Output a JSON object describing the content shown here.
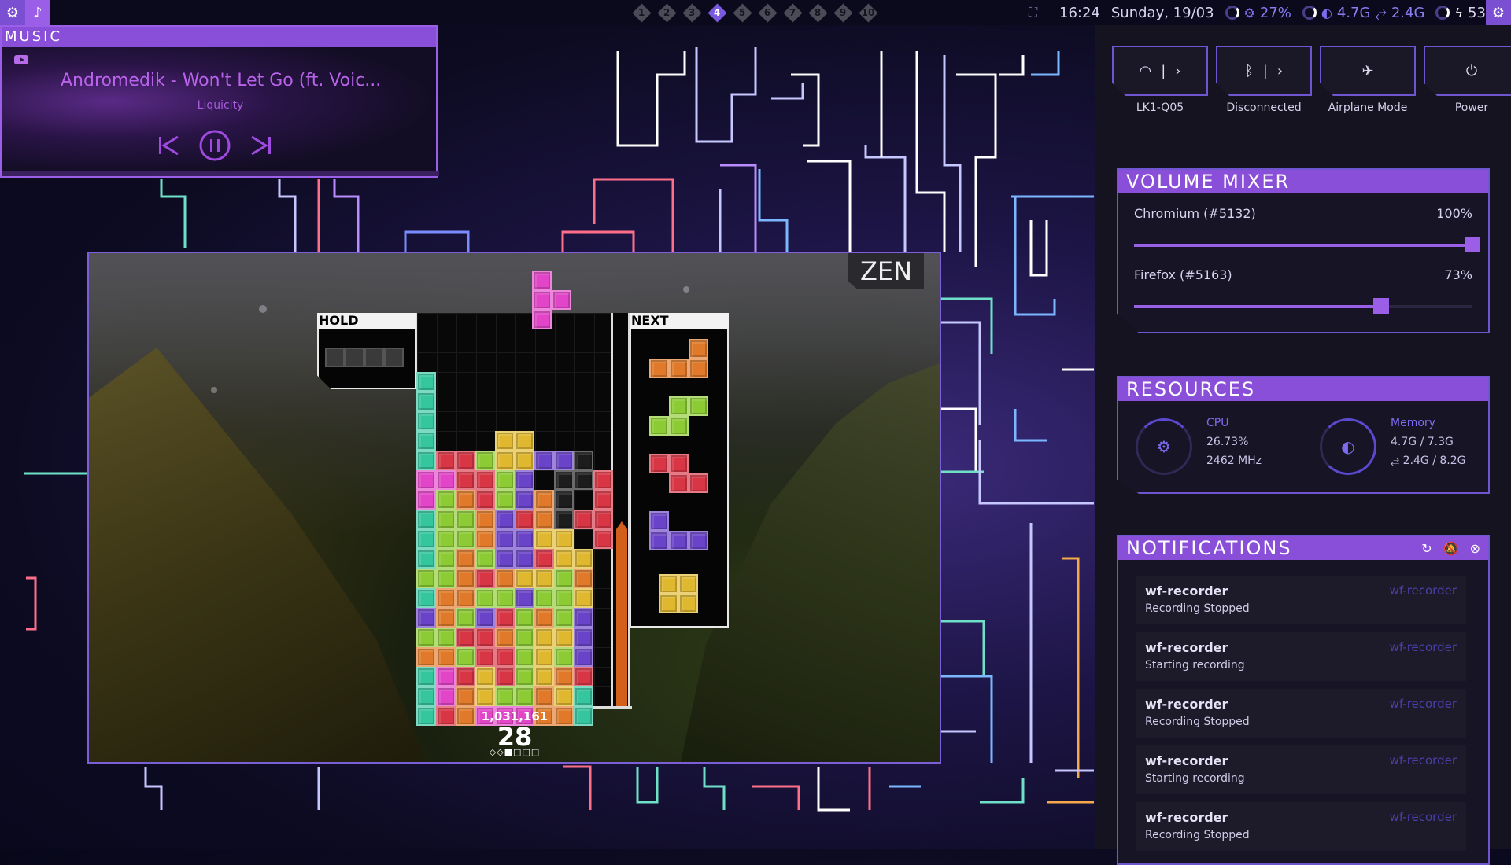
{
  "topbar": {
    "left_icons": [
      "gear-icon",
      "music-note-icon"
    ],
    "workspaces": [
      "1",
      "2",
      "3",
      "4",
      "5",
      "6",
      "7",
      "8",
      "9",
      "10"
    ],
    "active_workspace": 4,
    "time": "16:24",
    "date": "Sunday, 19/03",
    "cpu": "27%",
    "memory": "4.7G",
    "swap": "2.4G",
    "battery": "53%",
    "colors": {
      "accent": "#7a4fd1",
      "bar_bg": "#0b0a1c"
    }
  },
  "music": {
    "header": "MUSIC",
    "title": "Andromedik - Won't Let Go (ft. Voic...",
    "artist": "Liquicity",
    "source_icon": "youtube-icon"
  },
  "game": {
    "mode": "ZEN",
    "hold_label": "HOLD",
    "next_label": "NEXT",
    "score": "1,031,161",
    "lines": "28",
    "progress_marks": "◇◇■□□□",
    "gauge_level": 0.45,
    "current_piece": {
      "type": "T",
      "color": "#e245c8"
    },
    "next_queue": [
      {
        "type": "L",
        "color": "#e07a2a"
      },
      {
        "type": "S",
        "color": "#8ccb34"
      },
      {
        "type": "Z",
        "color": "#d83545"
      },
      {
        "type": "J",
        "color": "#6a44c8"
      },
      {
        "type": "O",
        "color": "#e0b830"
      }
    ],
    "hold_piece": {
      "type": "I",
      "color": "#3a3a3a"
    }
  },
  "quick_toggles": [
    {
      "name": "wifi",
      "label": "LK1-Q05",
      "icon": "wifi-icon"
    },
    {
      "name": "bluetooth",
      "label": "Disconnected",
      "icon": "bluetooth-icon"
    },
    {
      "name": "airplane",
      "label": "Airplane Mode",
      "icon": "airplane-icon"
    },
    {
      "name": "power",
      "label": "Power",
      "icon": "power-icon"
    }
  ],
  "volume_mixer": {
    "header": "VOLUME MIXER",
    "items": [
      {
        "name": "Chromium (#5132)",
        "value": "100%",
        "level": 1.0
      },
      {
        "name": "Firefox (#5163)",
        "value": "73%",
        "level": 0.73
      }
    ]
  },
  "resources": {
    "header": "RESOURCES",
    "cpu": {
      "title": "CPU",
      "usage": "26.73%",
      "freq": "2462 MHz",
      "level": 0.27
    },
    "memory": {
      "title": "Memory",
      "ram": "4.7G / 7.3G",
      "swap": "2.4G / 8.2G",
      "level": 0.64
    }
  },
  "notifications": {
    "header": "NOTIFICATIONS",
    "items": [
      {
        "app": "wf-recorder",
        "body": "Recording Stopped",
        "source": "wf-recorder"
      },
      {
        "app": "wf-recorder",
        "body": "Starting recording",
        "source": "wf-recorder"
      },
      {
        "app": "wf-recorder",
        "body": "Recording Stopped",
        "source": "wf-recorder"
      },
      {
        "app": "wf-recorder",
        "body": "Starting recording",
        "source": "wf-recorder"
      },
      {
        "app": "wf-recorder",
        "body": "Recording Stopped",
        "source": "wf-recorder"
      }
    ]
  }
}
